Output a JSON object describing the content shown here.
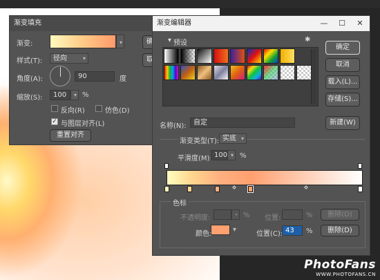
{
  "fill_dialog": {
    "title": "渐变填充",
    "gradient_label": "渐变:",
    "style_label": "样式(T):",
    "style_value": "径向",
    "angle_label": "角度(A):",
    "angle_value": "90",
    "angle_unit": "度",
    "scale_label": "缩放(S):",
    "scale_value": "100",
    "scale_unit": "%",
    "reverse_label": "反向(R)",
    "dither_label": "仿色(D)",
    "align_label": "与图层对齐(L)",
    "reset_label": "重置对齐",
    "ok_partial": "确",
    "cancel_partial": "取",
    "align_checked": true
  },
  "editor": {
    "title": "渐变编辑器",
    "presets_label": "预设",
    "ok": "确定",
    "cancel": "取消",
    "load": "载入(L)...",
    "save": "存储(S)...",
    "name_label": "名称(N):",
    "name_value": "自定",
    "new_button": "新建(W)",
    "type_label": "渐变类型(T):",
    "type_value": "实底",
    "smooth_label": "平滑度(M):",
    "smooth_value": "100",
    "smooth_unit": "%",
    "stops_label": "色标",
    "opacity_label": "不透明度:",
    "opacity_unit": "%",
    "location_label_top": "位置:",
    "location_unit_top": "%",
    "delete_top": "删除(D)",
    "color_label": "颜色:",
    "color_value": "#ffa070",
    "location_label": "位置(C):",
    "location_value": "43",
    "location_unit": "%",
    "delete_bottom": "删除(D)",
    "gradient_colors": [
      "#ffffc0",
      "#ffd890",
      "#ffb080",
      "#ffa070",
      "#ffffff"
    ]
  },
  "watermark": {
    "brand": "PhotoFans",
    "url": "WWW.PHOTOFANS.CN"
  }
}
